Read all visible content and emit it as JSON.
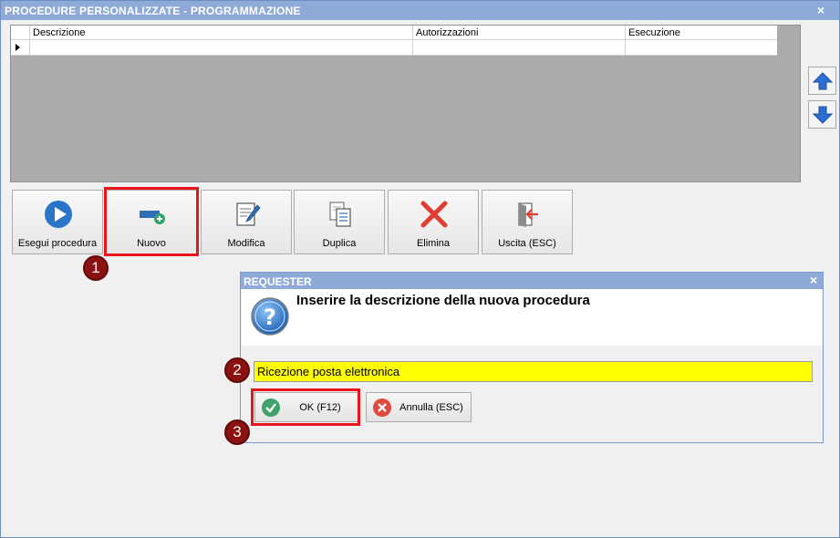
{
  "window": {
    "title": "PROCEDURE PERSONALIZZATE -  PROGRAMMAZIONE",
    "close_glyph": "×"
  },
  "grid": {
    "columns": [
      "Descrizione",
      "Autorizzazioni",
      "Esecuzione"
    ],
    "rows": [
      [
        "",
        "",
        ""
      ]
    ]
  },
  "toolbar": {
    "buttons": [
      {
        "label": "Esegui procedura",
        "icon": "play-icon"
      },
      {
        "label": "Nuovo",
        "icon": "new-record-icon"
      },
      {
        "label": "Modifica",
        "icon": "edit-icon"
      },
      {
        "label": "Duplica",
        "icon": "duplicate-icon"
      },
      {
        "label": "Elimina",
        "icon": "delete-icon"
      },
      {
        "label": "Uscita (ESC)",
        "icon": "exit-icon"
      }
    ]
  },
  "side_buttons": {
    "up_icon": "arrow-up-icon",
    "down_icon": "arrow-down-icon"
  },
  "steps": [
    "1",
    "2",
    "3"
  ],
  "dialog": {
    "title": "REQUESTER",
    "close_glyph": "×",
    "message": "Inserire la descrizione della nuova procedura",
    "icon": "question-icon",
    "input_value": "Ricezione posta elettronica",
    "ok_label": "OK (F12)",
    "cancel_label": "Annulla (ESC)"
  },
  "colors": {
    "titlebar": "#8eaad8",
    "highlight": "#e8151c",
    "step_badge": "#8c1111",
    "input_bg": "#ffff00",
    "arrow_blue": "#2c6fd1"
  }
}
